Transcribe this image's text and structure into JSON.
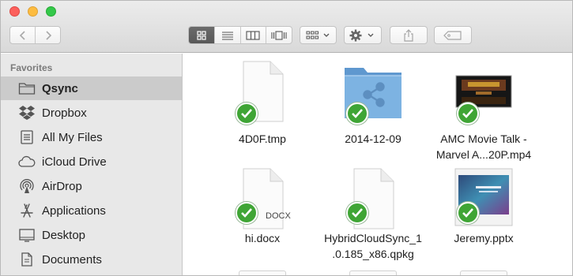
{
  "window": {
    "traffic_lights": [
      "close",
      "minimize",
      "zoom"
    ],
    "colors": {
      "close": "#fc605c",
      "minimize": "#fdbc40",
      "zoom": "#34c84a"
    }
  },
  "toolbar": {
    "nav": [
      {
        "icon": "chevron-left-icon"
      },
      {
        "icon": "chevron-right-icon"
      }
    ],
    "view_modes": [
      {
        "icon": "icon-view-icon",
        "active": true
      },
      {
        "icon": "list-view-icon",
        "active": false
      },
      {
        "icon": "column-view-icon",
        "active": false
      },
      {
        "icon": "cover-flow-view-icon",
        "active": false
      }
    ],
    "arrange_icon": "arrange-icon",
    "action_icon": "gear-icon",
    "share_icon": "share-icon",
    "tag_icon": "tag-icon"
  },
  "sidebar": {
    "heading": "Favorites",
    "items": [
      {
        "label": "Qsync",
        "icon": "folder-icon",
        "selected": true
      },
      {
        "label": "Dropbox",
        "icon": "dropbox-icon",
        "selected": false
      },
      {
        "label": "All My Files",
        "icon": "all-files-icon",
        "selected": false
      },
      {
        "label": "iCloud Drive",
        "icon": "cloud-icon",
        "selected": false
      },
      {
        "label": "AirDrop",
        "icon": "airdrop-icon",
        "selected": false
      },
      {
        "label": "Applications",
        "icon": "applications-icon",
        "selected": false
      },
      {
        "label": "Desktop",
        "icon": "desktop-icon",
        "selected": false
      },
      {
        "label": "Documents",
        "icon": "documents-icon",
        "selected": false
      }
    ]
  },
  "files": [
    {
      "name": "4D0F.tmp",
      "kind": "document",
      "synced": true
    },
    {
      "name": "2014-12-09",
      "kind": "shared-folder",
      "synced": true
    },
    {
      "name_line1": "AMC Movie Talk -",
      "name_line2": "Marvel A...20P.mp4",
      "kind": "video",
      "synced": true
    },
    {
      "name": "hi.docx",
      "kind": "document",
      "ext_label": "DOCX",
      "synced": true
    },
    {
      "name_line1": "HybridCloudSync_1",
      "name_line2": ".0.185_x86.qpkg",
      "kind": "document",
      "synced": true
    },
    {
      "name": "Jeremy.pptx",
      "kind": "presentation",
      "synced": true
    }
  ],
  "colors": {
    "sync_check": "#3fa535",
    "folder_blue": "#6fa6d6",
    "sidebar_bg": "#e8e8e8",
    "sidebar_selected": "#cbcbcb"
  }
}
